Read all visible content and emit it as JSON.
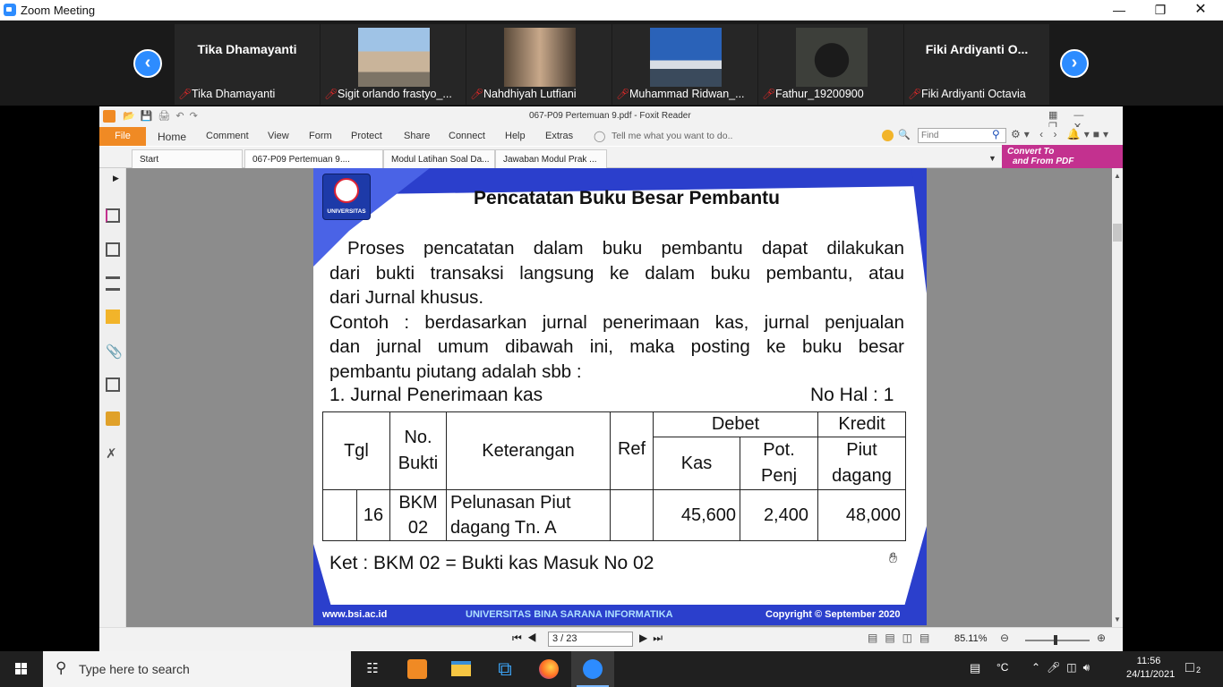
{
  "zoom": {
    "title": "Zoom Meeting",
    "participants": [
      {
        "name": "Tika Dhamayanti",
        "label": "Tika Dhamayanti",
        "video": false
      },
      {
        "name": "",
        "label": "Sigit orlando frastyo_...",
        "video": true
      },
      {
        "name": "",
        "label": "Nahdhiyah Lutfiani",
        "video": true
      },
      {
        "name": "",
        "label": "Muhammad Ridwan_...",
        "video": true
      },
      {
        "name": "",
        "label": "Fathur_19200900",
        "video": true
      },
      {
        "name": "Fiki Ardiyanti O...",
        "label": "Fiki Ardiyanti Octavia",
        "video": false
      }
    ]
  },
  "foxit": {
    "title": "067-P09 Pertemuan 9.pdf - Foxit Reader",
    "menu": {
      "file": "File",
      "items": [
        "Home",
        "Comment",
        "View",
        "Form",
        "Protect",
        "Share",
        "Connect",
        "Help",
        "Extras"
      ],
      "tell_me": "Tell me what you want to do..",
      "find_placeholder": "Find"
    },
    "tabs": [
      "Start",
      "067-P09 Pertemuan 9....",
      "Modul Latihan Soal Da...",
      "Jawaban Modul Prak ..."
    ],
    "convert_line1": "Convert To",
    "convert_line2": "and From PDF",
    "status": {
      "page": "3 / 23",
      "zoom": "85.11%"
    }
  },
  "slide": {
    "logo_text": "UNIVERSITAS",
    "title": "Pencatatan Buku Besar Pembantu",
    "para1_l1": "Proses pencatatan dalam buku pembantu dapat dilakukan",
    "para1_l2": "dari bukti transaksi langsung ke dalam buku pembantu, atau",
    "para1_l3": "dari Jurnal khusus.",
    "para2_l1": "Contoh : berdasarkan jurnal penerimaan kas, jurnal penjualan",
    "para2_l2": "dan jurnal umum dibawah ini, maka posting ke buku besar",
    "para2_l3": "pembantu piutang adalah sbb :",
    "list_item": "1.  Jurnal Penerimaan kas",
    "no_hal": "No Hal : 1",
    "table": {
      "h_tgl": "Tgl",
      "h_nobukti1": "No.",
      "h_nobukti2": "Bukti",
      "h_ket": "Keterangan",
      "h_ref": "Ref",
      "h_debet": "Debet",
      "h_kredit": "Kredit",
      "h_kas": "Kas",
      "h_pot1": "Pot.",
      "h_pot2": "Penj",
      "h_piut1": "Piut",
      "h_piut2": "dagang",
      "r_tgl": "16",
      "r_bukti1": "BKM",
      "r_bukti2": "02",
      "r_ket1": "Pelunasan Piut",
      "r_ket2": "dagang  Tn. A",
      "r_kas": "45,600",
      "r_pot": "2,400",
      "r_piut": "48,000"
    },
    "ket": "Ket : BKM 02 = Bukti kas Masuk No 02",
    "footer_left": "www.bsi.ac.id",
    "footer_mid": "UNIVERSITAS BINA SARANA INFORMATIKA",
    "footer_right": "Copyright © September 2020"
  },
  "taskbar": {
    "search_placeholder": "Type here to search",
    "temp_unit": "°C",
    "time": "11:56",
    "date": "24/11/2021",
    "notif_count": "2"
  },
  "colors": {
    "zoom_blue": "#2d8cff",
    "foxit_orange": "#f08a24",
    "slide_blue": "#2b3fcc",
    "convert_magenta": "#c3318f"
  }
}
